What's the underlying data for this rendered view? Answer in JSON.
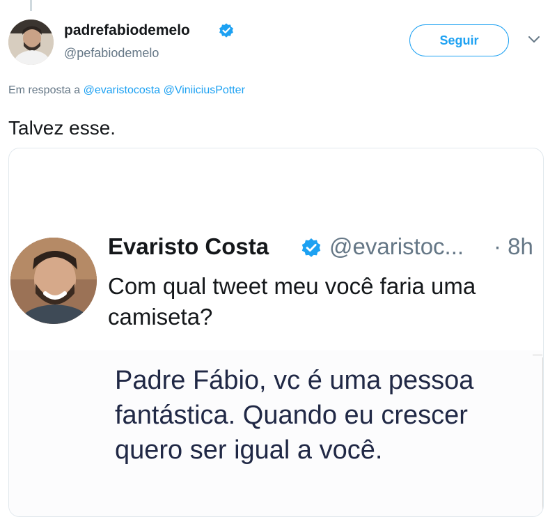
{
  "author": {
    "display_name": "padrefabiodemelo",
    "handle": "@pefabiodemelo",
    "verified": true
  },
  "follow_button": {
    "label": "Seguir"
  },
  "menu": {
    "icon": "chevron-down-icon"
  },
  "reply_context": {
    "prefix": "Em resposta a",
    "mentions": [
      "@evaristocosta",
      "@ViniiciusPotter"
    ]
  },
  "tweet": {
    "text": "Talvez esse."
  },
  "quoted": {
    "name": "Evaristo Costa",
    "handle": "@evaristoc...",
    "time": "· 8h",
    "verified": true,
    "text": "Com qual tweet meu você faria uma camiseta?"
  },
  "image_text": "Padre Fábio, vc é uma pessoa fantástica. Quando eu crescer quero ser igual a você.",
  "colors": {
    "accent": "#1da1f2",
    "text": "#14171a",
    "muted": "#657786",
    "border": "#e1e8ed"
  }
}
